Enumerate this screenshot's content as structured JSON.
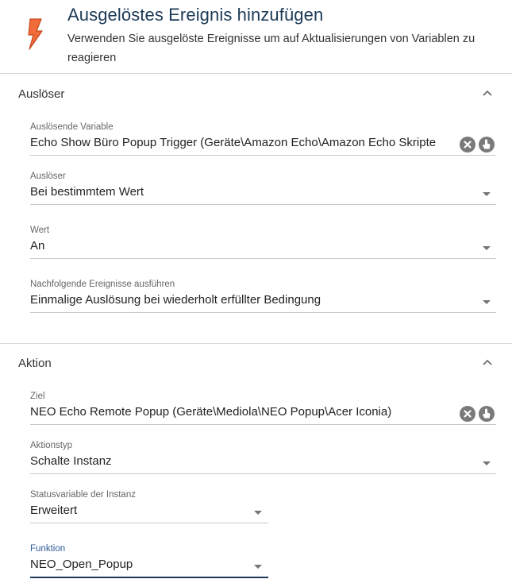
{
  "header": {
    "title": "Ausgelöstes Ereignis hinzufügen",
    "subtitle": "Verwenden Sie ausgelöste Ereignisse um auf Aktualisierungen von Variablen zu reagieren",
    "icon": "lightning-icon",
    "icon_color": "#f26b3a"
  },
  "trigger_section": {
    "title": "Auslöser",
    "fields": {
      "variable": {
        "label": "Auslösende Variable",
        "value": "Echo Show Büro Popup Trigger (Geräte\\Amazon Echo\\Amazon Echo Skripte"
      },
      "trigger": {
        "label": "Auslöser",
        "value": "Bei bestimmtem Wert"
      },
      "value": {
        "label": "Wert",
        "value": "An"
      },
      "subsequent": {
        "label": "Nachfolgende Ereignisse ausführen",
        "value": "Einmalige Auslösung bei wiederholt erfüllter Bedingung"
      }
    }
  },
  "action_section": {
    "title": "Aktion",
    "fields": {
      "target": {
        "label": "Ziel",
        "value": "NEO Echo Remote Popup (Geräte\\Mediola\\NEO Popup\\Acer Iconia)"
      },
      "action_type": {
        "label": "Aktionstyp",
        "value": "Schalte Instanz"
      },
      "status_variable": {
        "label": "Statusvariable der Instanz",
        "value": "Erweitert"
      },
      "function": {
        "label": "Funktion",
        "value": "NEO_Open_Popup"
      }
    }
  },
  "colors": {
    "title": "#1c3a57",
    "accent_focus": "#2f5b9a",
    "icon_button": "#7a7a7a"
  }
}
